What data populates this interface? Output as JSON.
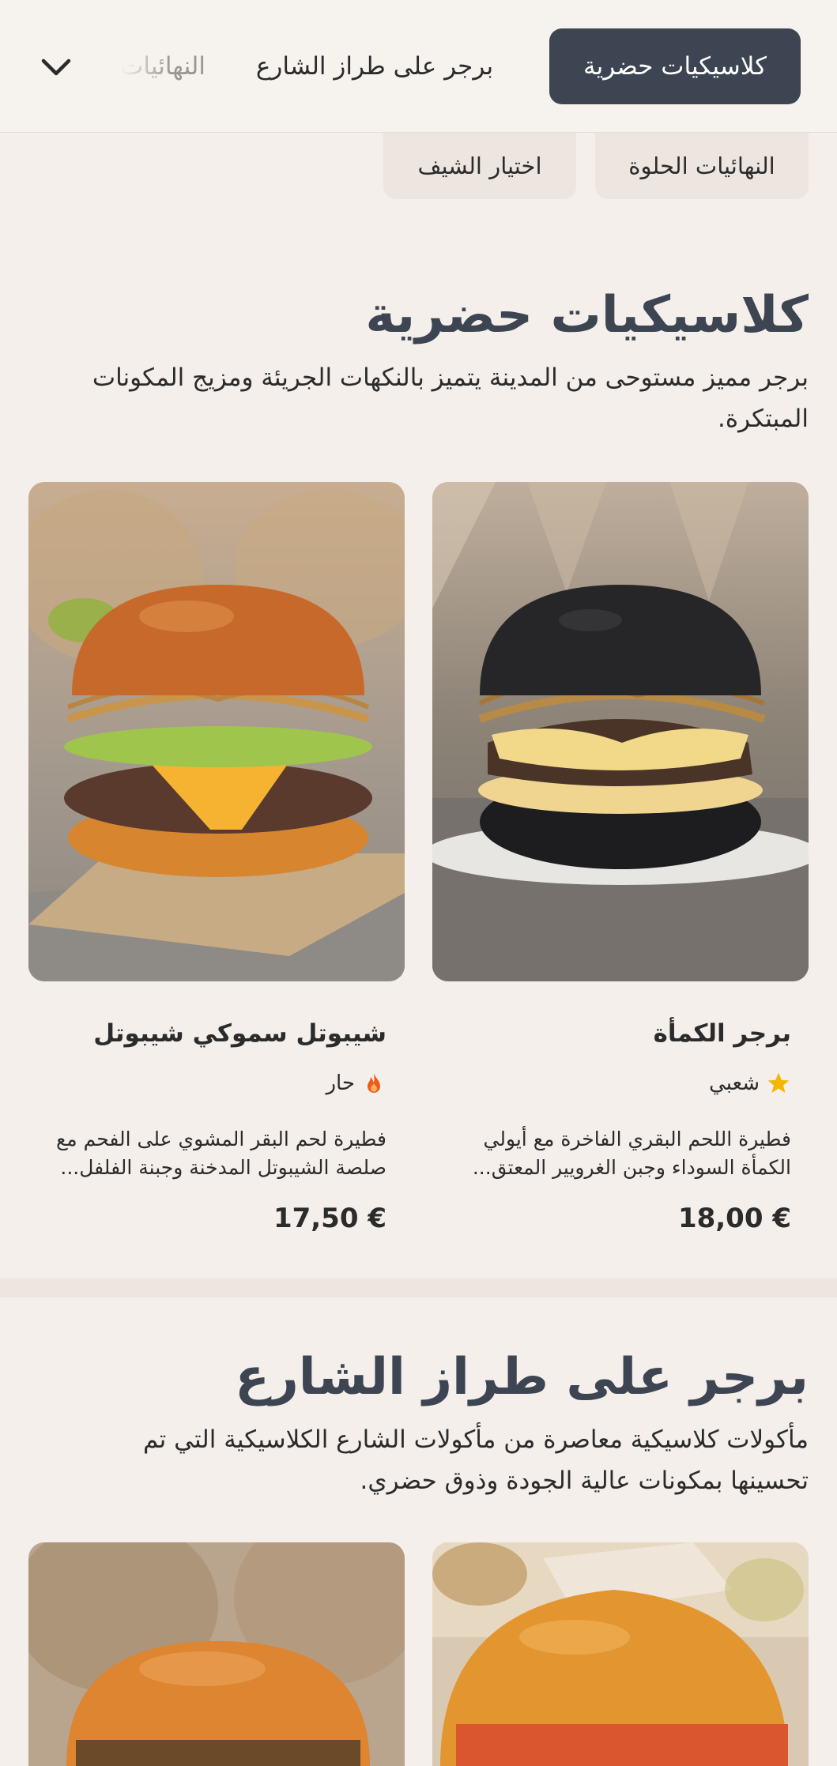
{
  "categories": {
    "active": "كلاسيكيات حضرية",
    "street": "برجر على طراز الشارع",
    "sweet_truncated": "النهائيات",
    "sweet": "النهائيات الحلوة",
    "chef": "اختيار الشيف"
  },
  "section1": {
    "title": "كلاسيكيات حضرية",
    "description": "برجر مميز مستوحى من المدينة يتميز بالنكهات الجريئة ومزيج المكونات المبتكرة.",
    "items": [
      {
        "name": "برجر الكمأة",
        "tag": "شعبي",
        "tag_icon": "star-icon",
        "description": "فطيرة اللحم البقري الفاخرة مع أيولي الكمأة السوداء وجبن الغرويير المعتق...",
        "price": "18,00 €"
      },
      {
        "name": "شيبوتل سموكي شيبوتل",
        "tag": "حار",
        "tag_icon": "fire-icon",
        "description": "فطيرة لحم البقر المشوي على الفحم مع صلصة الشيبوتل المدخنة وجبنة الفلفل...",
        "price": "17,50 €"
      }
    ]
  },
  "section2": {
    "title": "برجر على طراز الشارع",
    "description": "مأكولات كلاسيكية معاصرة من مأكولات الشارع الكلاسيكية التي تم تحسينها بمكونات عالية الجودة وذوق حضري."
  },
  "colors": {
    "accent": "#3d4552",
    "background": "#f4efeb",
    "star": "#f2b705",
    "fire": "#f05a1a"
  }
}
